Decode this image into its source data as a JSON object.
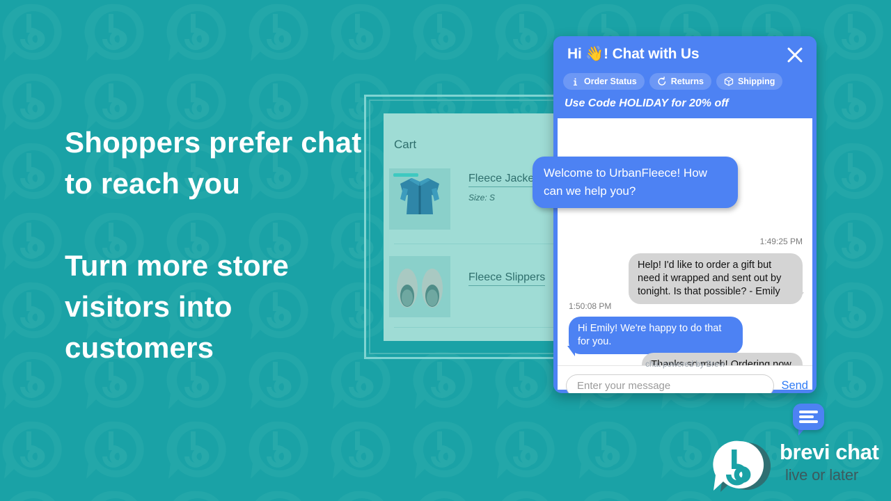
{
  "theme": {
    "background": "#1aa2a6",
    "brand_blue": "#4d82f3",
    "panel_teal": "#9fdcd5",
    "text_white": "#ffffff"
  },
  "headline": {
    "line1": "Shoppers prefer chat to reach you",
    "line2": "Turn more store visitors into customers"
  },
  "store": {
    "cart_title": "Cart",
    "items": [
      {
        "name": "Fleece Jacket",
        "meta": "Size: S",
        "thumb": "jacket-image"
      },
      {
        "name": "Fleece Slippers",
        "meta": "",
        "thumb": "slippers-image"
      }
    ]
  },
  "chat": {
    "title": "Hi 👋! Chat with Us",
    "close_icon": "close-icon",
    "quick_actions": [
      {
        "label": "Order Status",
        "icon": "info-icon"
      },
      {
        "label": "Returns",
        "icon": "return-arrow-icon"
      },
      {
        "label": "Shipping",
        "icon": "package-box-icon"
      }
    ],
    "promo": "Use Code HOLIDAY for 20% off",
    "messages": [
      {
        "from": "agent",
        "text": "Welcome to UrbanFleece! How can we help you?",
        "timestamp": ""
      },
      {
        "from": "user",
        "text": "Help! I'd like to order a gift but need it wrapped and sent out by tonight. Is that possible? - Emily",
        "timestamp": "1:49:25 PM"
      },
      {
        "from": "agent",
        "text": "Hi Emily! We're happy to do that for you.",
        "timestamp": "1:50:08 PM"
      },
      {
        "from": "user",
        "text": "Thanks so much! Ordering now.",
        "timestamp": ""
      }
    ],
    "powered_by": "chat powered by Brevi",
    "input_placeholder": "Enter your message",
    "input_value": "",
    "send_label": "Send"
  },
  "launcher": {
    "icon": "chat-bubble-icon"
  },
  "brand": {
    "name": "brevi chat",
    "tagline": "live or later",
    "logo_icon": "brevi-b-logo"
  }
}
